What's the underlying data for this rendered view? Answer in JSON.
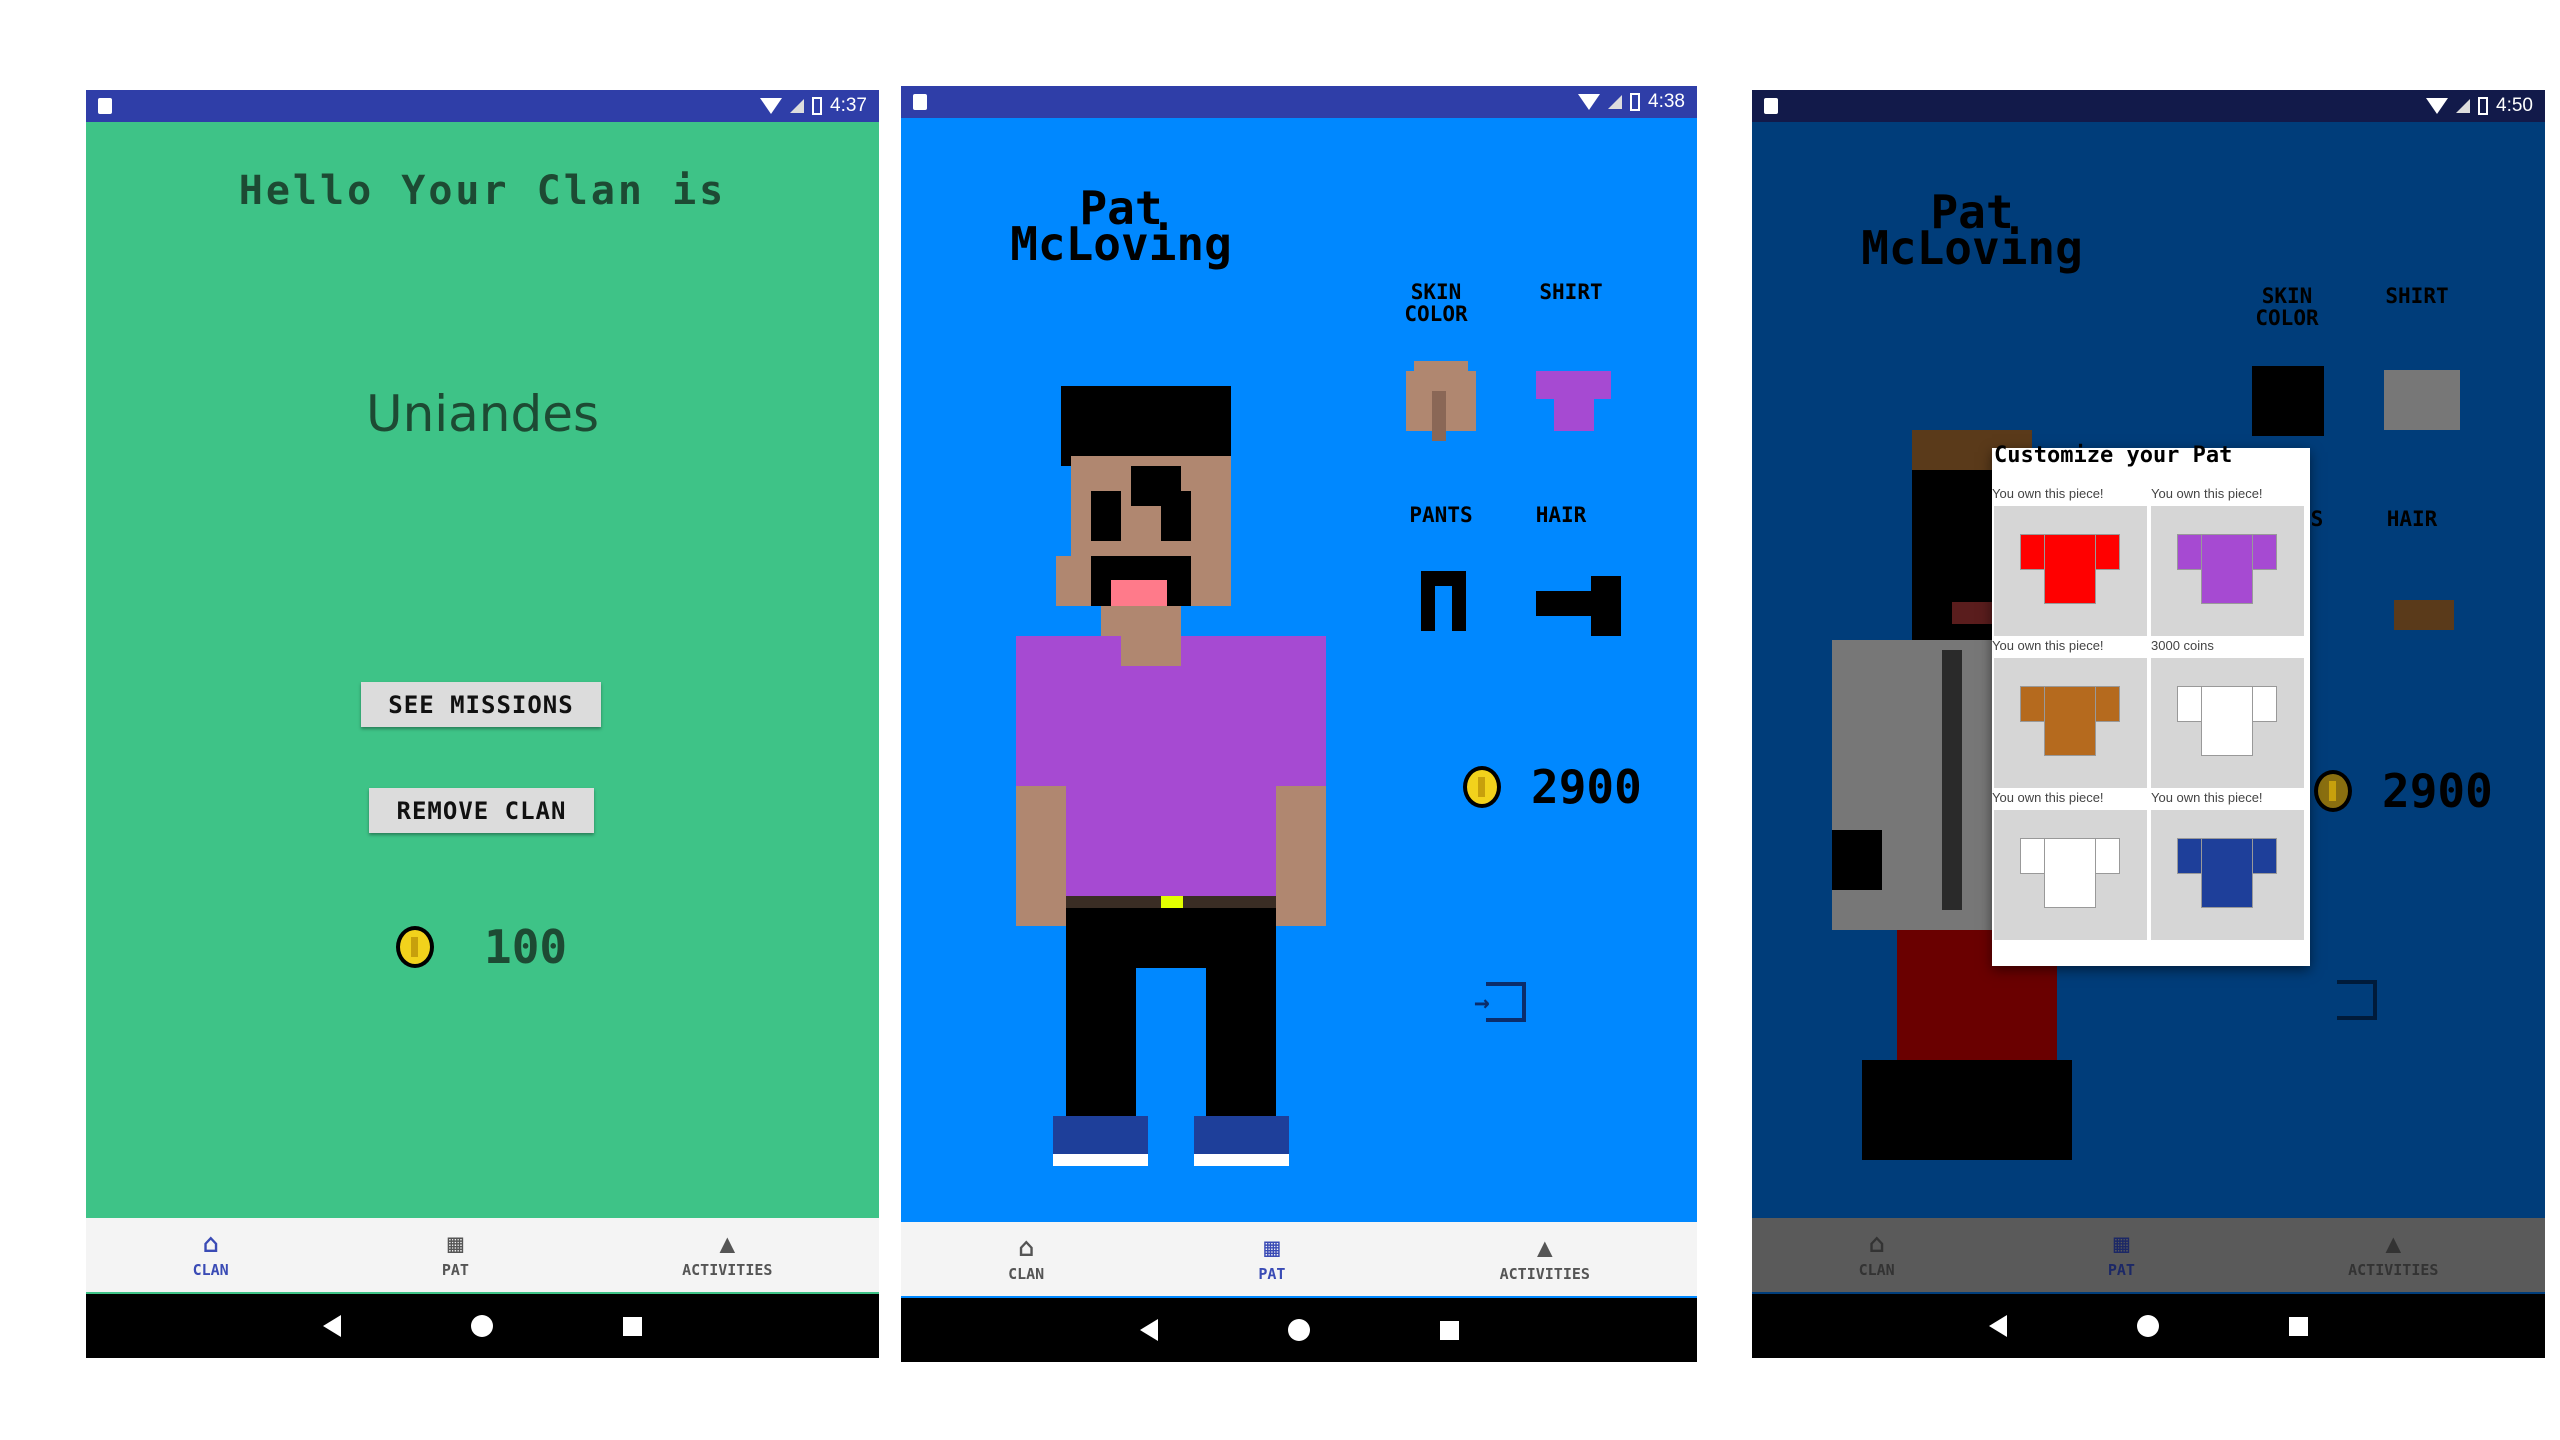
{
  "screens": [
    {
      "status": {
        "time": "4:37"
      },
      "greeting": "Hello Your Clan is",
      "clan_name": "Uniandes",
      "see_missions_label": "SEE MISSIONS",
      "remove_clan_label": "REMOVE CLAN",
      "coins": "100",
      "nav": [
        "CLAN",
        "PAT",
        "ACTIVITIES"
      ],
      "active_tab": "CLAN"
    },
    {
      "status": {
        "time": "4:38"
      },
      "pet_name": "Pat McLoving",
      "categories": {
        "skin": "SKIN COLOR",
        "shirt": "SHIRT",
        "pants": "PANTS",
        "hair": "HAIR"
      },
      "coins": "2900",
      "nav": [
        "CLAN",
        "PAT",
        "ACTIVITIES"
      ],
      "active_tab": "PAT"
    },
    {
      "status": {
        "time": "4:50"
      },
      "pet_name": "Pat McLoving",
      "categories": {
        "skin": "SKIN COLOR",
        "shirt": "SHIRT",
        "pants": "S",
        "hair": "HAIR"
      },
      "coins": "2900",
      "dialog": {
        "title": "Customize your Pat",
        "items": [
          {
            "status": "You own this piece!",
            "color": "#ff0000"
          },
          {
            "status": "You own this piece!",
            "color": "#a64ad2"
          },
          {
            "status": "You own this piece!",
            "color": "#b56a1e"
          },
          {
            "status": "3000 coins",
            "color": "#ffffff"
          },
          {
            "status": "You own this piece!",
            "color": "#ffffff"
          },
          {
            "status": "You own this piece!",
            "color": "#1e3f9a"
          }
        ]
      },
      "nav": [
        "CLAN",
        "PAT",
        "ACTIVITIES"
      ],
      "active_tab": "PAT"
    }
  ],
  "colors": {
    "clan_bg": "#3ec387",
    "pat_bg": "#0088ff",
    "status_blue": "#2f3ea8",
    "nav_active": "#3a4bb5",
    "shirt_purple": "#a64ad2",
    "skin": "#b08770"
  }
}
